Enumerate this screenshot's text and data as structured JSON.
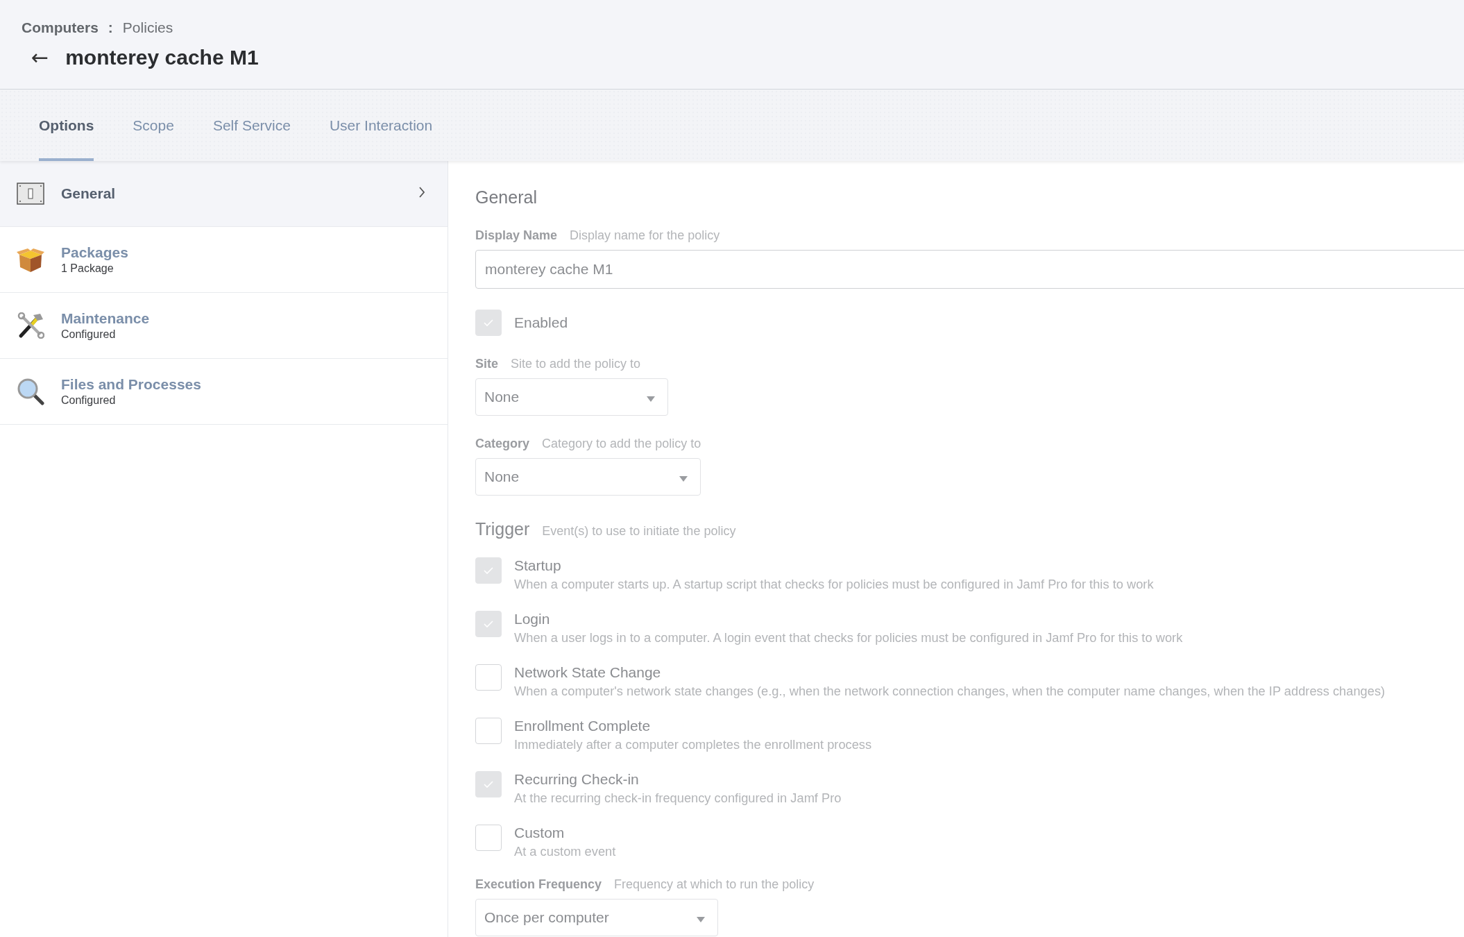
{
  "breadcrumb": {
    "parent": "Computers",
    "separator": ":",
    "current": "Policies"
  },
  "back_icon": "←",
  "title": "monterey cache M1",
  "tabs": [
    {
      "label": "Options",
      "selected": true
    },
    {
      "label": "Scope",
      "selected": false
    },
    {
      "label": "Self Service",
      "selected": false
    },
    {
      "label": "User Interaction",
      "selected": false
    }
  ],
  "sidebar": {
    "items": [
      {
        "kind": "switch",
        "title": "General",
        "selected": true
      },
      {
        "kind": "package",
        "title": "Packages",
        "subtitle": "1 Package",
        "selected": false
      },
      {
        "kind": "tools",
        "title": "Maintenance",
        "subtitle": "Configured",
        "selected": false
      },
      {
        "kind": "magnifier",
        "title": "Files and Processes",
        "subtitle": "Configured",
        "selected": false
      }
    ]
  },
  "form": {
    "heading": "General",
    "display_name": {
      "label": "Display Name",
      "hint": "Display name for the policy",
      "value": "monterey cache M1"
    },
    "enabled": {
      "label": "Enabled",
      "checked": true
    },
    "site": {
      "label": "Site",
      "hint": "Site to add the policy to",
      "value": "None"
    },
    "category": {
      "label": "Category",
      "hint": "Category to add the policy to",
      "value": "None"
    },
    "trigger": {
      "label": "Trigger",
      "hint": "Event(s) to use to initiate the policy",
      "options": [
        {
          "label": "Startup",
          "description": "When a computer starts up. A startup script that checks for policies must be configured in Jamf Pro for this to work",
          "checked": true
        },
        {
          "label": "Login",
          "description": "When a user logs in to a computer. A login event that checks for policies must be configured in Jamf Pro for this to work",
          "checked": true
        },
        {
          "label": "Network State Change",
          "description": "When a computer's network state changes (e.g., when the network connection changes, when the computer name changes, when the IP address changes)",
          "checked": false
        },
        {
          "label": "Enrollment Complete",
          "description": "Immediately after a computer completes the enrollment process",
          "checked": false
        },
        {
          "label": "Recurring Check-in",
          "description": "At the recurring check-in frequency configured in Jamf Pro",
          "checked": true
        },
        {
          "label": "Custom",
          "description": "At a custom event",
          "checked": false
        }
      ]
    },
    "execution_frequency": {
      "label": "Execution Frequency",
      "hint": "Frequency at which to run the policy",
      "value": "Once per computer"
    }
  }
}
